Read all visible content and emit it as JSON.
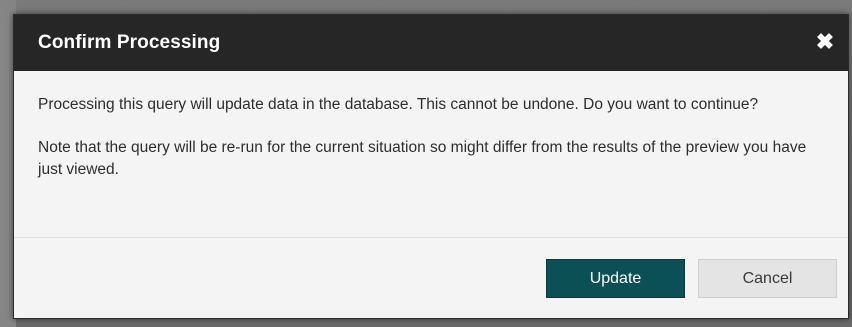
{
  "dialog": {
    "title": "Confirm Processing",
    "close_glyph": "✖",
    "close_icon": "close-icon",
    "paragraphs": [
      "Processing this query will update data in the database. This cannot be undone. Do you want to continue?",
      "Note that the query will be re-run for the current situation so might differ from the results of the preview you have just viewed."
    ],
    "buttons": {
      "update_label": "Update",
      "cancel_label": "Cancel"
    }
  },
  "colors": {
    "titlebar": "#262626",
    "primary_button": "#0b5054",
    "secondary_button": "#e4e4e4",
    "dialog_background": "#f4f4f4"
  }
}
